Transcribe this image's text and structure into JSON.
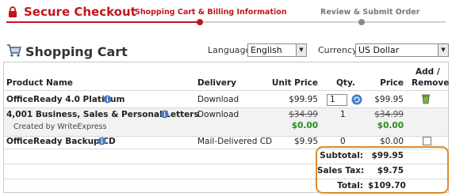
{
  "header": {
    "brand": "Secure Checkout",
    "steps": [
      {
        "label": "Shopping Cart & Billing Information",
        "active": true
      },
      {
        "label": "Review & Submit Order",
        "active": false
      }
    ]
  },
  "title": "Shopping Cart",
  "language": {
    "label": "Language:",
    "value": "English"
  },
  "currency": {
    "label": "Currency:",
    "value": "US Dollar"
  },
  "table": {
    "headers": {
      "product": "Product Name",
      "delivery": "Delivery",
      "unit_price": "Unit Price",
      "qty": "Qty.",
      "price": "Price",
      "add": "Add /",
      "remove": "Remove"
    },
    "rows": [
      {
        "name": "OfficeReady 4.0 Platinum",
        "delivery": "Download",
        "unit_price": "$99.95",
        "qty": "1",
        "price": "$99.95"
      },
      {
        "name": "4,001 Business, Sales & Personal Letters",
        "sub": "Created by WriteExpress",
        "delivery": "Download",
        "unit_price_old": "$34.99",
        "unit_price": "$0.00",
        "qty": "1",
        "price_old": "$34.99",
        "price": "$0.00"
      },
      {
        "name": "OfficeReady Backup CD",
        "delivery": "Mail-Delivered CD",
        "unit_price": "$9.95",
        "qty": "0",
        "price": "$0.00"
      }
    ]
  },
  "totals": {
    "subtotal_label": "Subtotal:",
    "subtotal": "$99.95",
    "tax_label": "Sales Tax:",
    "tax": "$9.75",
    "total_label": "Total:",
    "total": "$109.70"
  },
  "colors": {
    "brand": "#c0171c",
    "discount": "#2a8a1f",
    "highlight": "#e08a28"
  }
}
